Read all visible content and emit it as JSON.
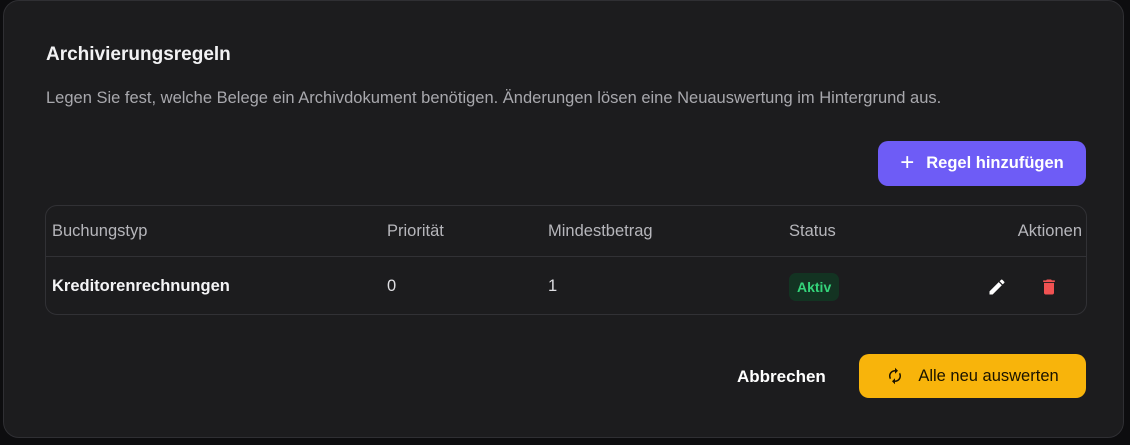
{
  "dialog": {
    "title": "Archivierungsregeln",
    "subtitle": "Legen Sie fest, welche Belege ein Archivdokument benötigen. Änderungen lösen eine Neuauswertung im Hintergrund aus.",
    "add_button_label": "Regel hinzufügen",
    "add_button_icon": "plus-icon",
    "cancel_label": "Abbrechen",
    "reevaluate_label": "Alle neu auswerten",
    "reevaluate_icon": "refresh-icon"
  },
  "table": {
    "headers": [
      "Buchungstyp",
      "Priorität",
      "Mindestbetrag",
      "Status",
      "Aktionen"
    ],
    "rows": [
      {
        "buchungstyp": "Kreditorenrechnungen",
        "prioritaet": "0",
        "mindestbetrag": "1",
        "status": "Aktiv",
        "actions": [
          "pencil-icon",
          "trash-icon"
        ]
      }
    ]
  },
  "colors": {
    "accent_purple": "#6e5cf6",
    "accent_yellow": "#f8b40b",
    "status_active": "#34d47a",
    "danger": "#f05252",
    "background": "#1c1c1e"
  }
}
